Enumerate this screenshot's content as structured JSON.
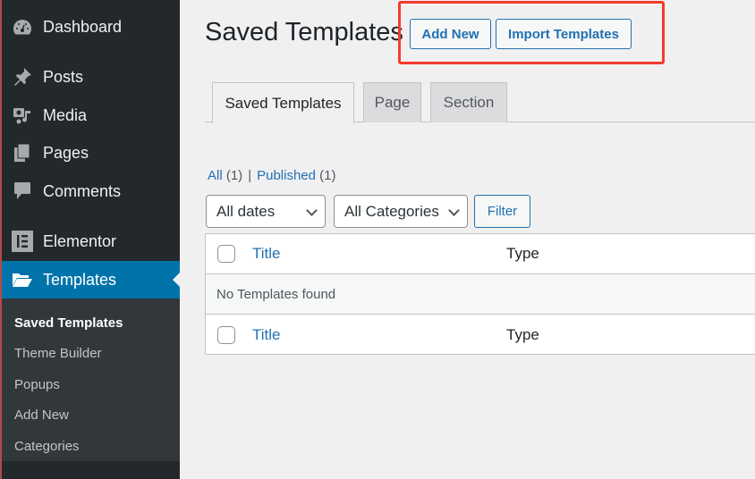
{
  "sidebar": {
    "menu": [
      {
        "label": "Dashboard",
        "icon": "dashboard-icon"
      },
      {
        "label": "Posts",
        "icon": "pin-icon"
      },
      {
        "label": "Media",
        "icon": "media-icon"
      },
      {
        "label": "Pages",
        "icon": "pages-icon"
      },
      {
        "label": "Comments",
        "icon": "comment-icon"
      },
      {
        "label": "Elementor",
        "icon": "elementor-icon"
      },
      {
        "label": "Templates",
        "icon": "folder-open-icon"
      }
    ],
    "submenu": [
      {
        "label": "Saved Templates"
      },
      {
        "label": "Theme Builder"
      },
      {
        "label": "Popups"
      },
      {
        "label": "Add New"
      },
      {
        "label": "Categories"
      }
    ]
  },
  "header": {
    "title": "Saved Templates",
    "add_new_label": "Add New",
    "import_label": "Import Templates"
  },
  "tabs": [
    {
      "label": "Saved Templates",
      "active": true
    },
    {
      "label": "Page",
      "active": false
    },
    {
      "label": "Section",
      "active": false
    }
  ],
  "views": {
    "all_label": "All",
    "all_count": "(1)",
    "separator": "|",
    "published_label": "Published",
    "published_count": "(1)"
  },
  "filters": {
    "dates_value": "All dates",
    "categories_value": "All Categories",
    "filter_label": "Filter"
  },
  "table": {
    "columns": [
      "Title",
      "Type"
    ],
    "empty_message": "No Templates found"
  },
  "colors": {
    "accent": "#2271b1",
    "active_menu": "#0073aa",
    "highlight": "#f43b2e"
  }
}
